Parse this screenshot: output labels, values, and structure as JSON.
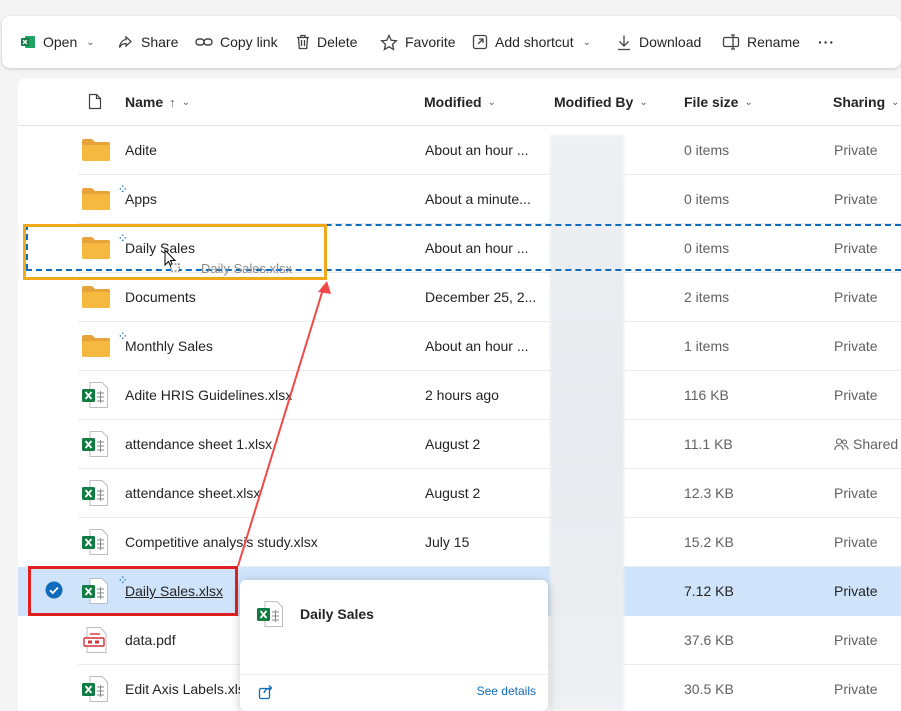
{
  "toolbar": {
    "open": "Open",
    "share": "Share",
    "copy_link": "Copy link",
    "delete": "Delete",
    "favorite": "Favorite",
    "add_shortcut": "Add shortcut",
    "download": "Download",
    "rename": "Rename",
    "more": "···"
  },
  "columns": {
    "name": "Name",
    "name_sort": "↑",
    "modified": "Modified",
    "modified_by": "Modified By",
    "file_size": "File size",
    "sharing": "Sharing"
  },
  "rows": [
    {
      "name": "Adite",
      "modified": "About an hour ...",
      "size": "0 items",
      "sharing": "Private"
    },
    {
      "name": "Apps",
      "modified": "About a minute...",
      "size": "0 items",
      "sharing": "Private"
    },
    {
      "name": "Daily Sales",
      "modified": "About an hour ...",
      "size": "0 items",
      "sharing": "Private"
    },
    {
      "name": "Documents",
      "modified": "December 25, 2...",
      "size": "2 items",
      "sharing": "Private"
    },
    {
      "name": "Monthly Sales",
      "modified": "About an hour ...",
      "size": "1 items",
      "sharing": "Private"
    },
    {
      "name": "Adite HRIS Guidelines.xlsx",
      "modified": "2 hours ago",
      "size": "116 KB",
      "sharing": "Private"
    },
    {
      "name": "attendance sheet 1.xlsx",
      "modified": "August 2",
      "size": "11.1 KB",
      "sharing": "Shared"
    },
    {
      "name": "attendance sheet.xlsx",
      "modified": "August 2",
      "size": "12.3 KB",
      "sharing": "Private"
    },
    {
      "name": "Competitive analysis study.xlsx",
      "modified": "July 15",
      "size": "15.2 KB",
      "sharing": "Private"
    },
    {
      "name": "Daily Sales.xlsx",
      "modified": "",
      "size": "7.12 KB",
      "sharing": "Private"
    },
    {
      "name": "data.pdf",
      "modified": "",
      "size": "37.6 KB",
      "sharing": "Private"
    },
    {
      "name": "Edit Axis Labels.xlsx",
      "modified": "",
      "size": "30.5 KB",
      "sharing": "Private"
    }
  ],
  "drag": {
    "ghost_label": "Daily Sales.xlsx"
  },
  "hover_card": {
    "title": "Daily Sales",
    "see_details": "See details"
  },
  "colors": {
    "accent": "#0f6cbd",
    "selected_row": "#cfe4fa",
    "highlight_orange": "#f0a81c",
    "highlight_red": "#e02020",
    "folder": "#f6b940",
    "excel": "#107c41"
  }
}
